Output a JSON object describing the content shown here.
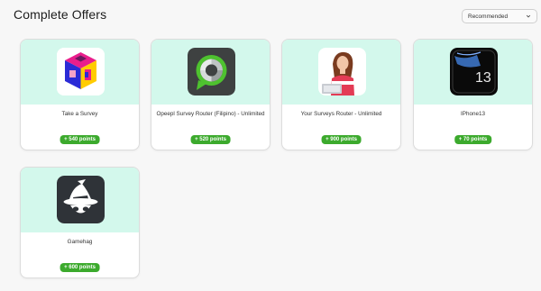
{
  "header": {
    "title": "Complete Offers"
  },
  "sort": {
    "selected": "Recommended"
  },
  "offers": [
    {
      "name": "Take a Survey",
      "points": "+ 540 points",
      "icon": "qmee-cube-icon"
    },
    {
      "name": "Opeepl Survey Router (Filipino) - Unlimited",
      "points": "+ 520 points",
      "icon": "opeepl-chat-ring-icon"
    },
    {
      "name": "Your Surveys Router - Unlimited",
      "points": "+ 900 points",
      "icon": "woman-laptop-photo"
    },
    {
      "name": "IPhone13",
      "points": "+ 70 points",
      "icon": "iphone13-icon"
    },
    {
      "name": "Gamehag",
      "points": "+ 600 points",
      "icon": "gamehag-wizard-icon"
    }
  ],
  "colors": {
    "accent": "#3caa2d",
    "card_top": "#d3f8ec",
    "iphone_number": "13"
  }
}
